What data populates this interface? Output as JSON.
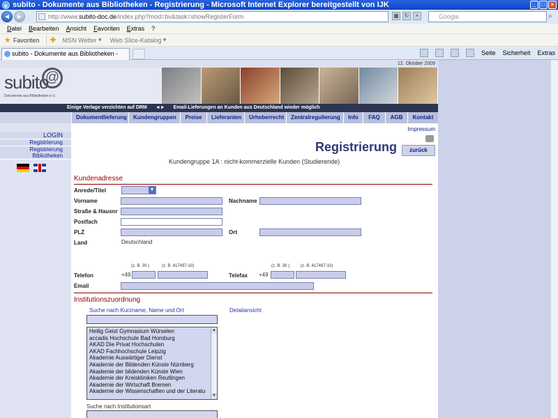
{
  "window": {
    "title": "subito - Dokumente aus Bibliotheken - Registrierung - Microsoft Internet Explorer bereitgestellt von IJK"
  },
  "browser": {
    "url_prefix": "http://www.",
    "url_host": "subito-doc.de",
    "url_path": "/index.php?mod=bv&task=showRegisterForm",
    "search_placeholder": "Google",
    "menu": [
      "Datei",
      "Bearbeiten",
      "Ansicht",
      "Favoriten",
      "Extras",
      "?"
    ],
    "favorites_label": "Favoriten",
    "fav_items": [
      "MSN Wetter",
      "Web Slice-Katalog"
    ],
    "tab_title": "subito - Dokumente aus Bibliotheken - Registrierung",
    "tools": [
      "Seite",
      "Sicherheit",
      "Extras"
    ]
  },
  "site": {
    "date": "12. Oktober 2009",
    "logo": "subito",
    "logo_sub": "Dokumente aus Bibliotheken e.V.",
    "news_left": "Einige Verlage verzichten auf DRM",
    "news_arrows": "◄►",
    "news_right": "Email-Lieferungen an Kunden aus Deutschland wieder möglich",
    "nav": [
      "Dokumentlieferung",
      "Kundengruppen",
      "Preise",
      "Lieferanten",
      "Urheberrecht",
      "Zentralregulierung",
      "Info",
      "FAQ",
      "AGB",
      "Kontakt"
    ],
    "side": {
      "login": "LOGIN",
      "registrierung": "Registrierung",
      "reg_bib_1": "Registrierung",
      "reg_bib_2": "Bibliotheken"
    },
    "impressum": "Impressum",
    "page_title": "Registrierung",
    "back": "zurück",
    "subtitle": "Kundengruppe 1A : nicht-kommerzielle Kunden (Studierende)"
  },
  "form": {
    "section_customer": "Kundenadresse",
    "anrede": "Anrede/Titel",
    "vorname": "Vorname",
    "nachname": "Nachname",
    "strasse": "Straße & Hausnr",
    "postfach": "Postfach",
    "plz": "PLZ",
    "ort": "Ort",
    "land": "Land",
    "land_value": "Deutschland",
    "telefon": "Telefon",
    "telefax": "Telefax",
    "email": "Email",
    "prefix": "+49",
    "hint_area": "(z. B. 30 )",
    "hint_number": "(z. B. 417497-10)",
    "section_institution": "Institutionszuordnung",
    "inst_search_label": "Suche nach Kurzname, Name und Ort",
    "detail_label": "Detailansicht",
    "institutions": [
      "Heilig Geist Gymnasium Würselen",
      "accadis Hochschule Bad Homburg",
      "AKAD Die Privat Hochschulen",
      "AKAD Fachhochschule Leipzig",
      "Akademie Auswärtiger Dienst",
      "Akademie der Bildenden Künste Nürnberg",
      "Akademie der bildenden Künste Wien",
      "Akademie der Kreiskliniken Reutlingen",
      "Akademie der Wirtschaft Bremen",
      "Akademie der Wissenschaften und der Literatu"
    ],
    "inst_type_label": "Suche nach Institutionsart"
  },
  "colors": {
    "title_blue": "#2d3a7a",
    "nav_text": "#0a1f86",
    "section_red": "#8b0000",
    "field_fill": "#c9cdea"
  }
}
